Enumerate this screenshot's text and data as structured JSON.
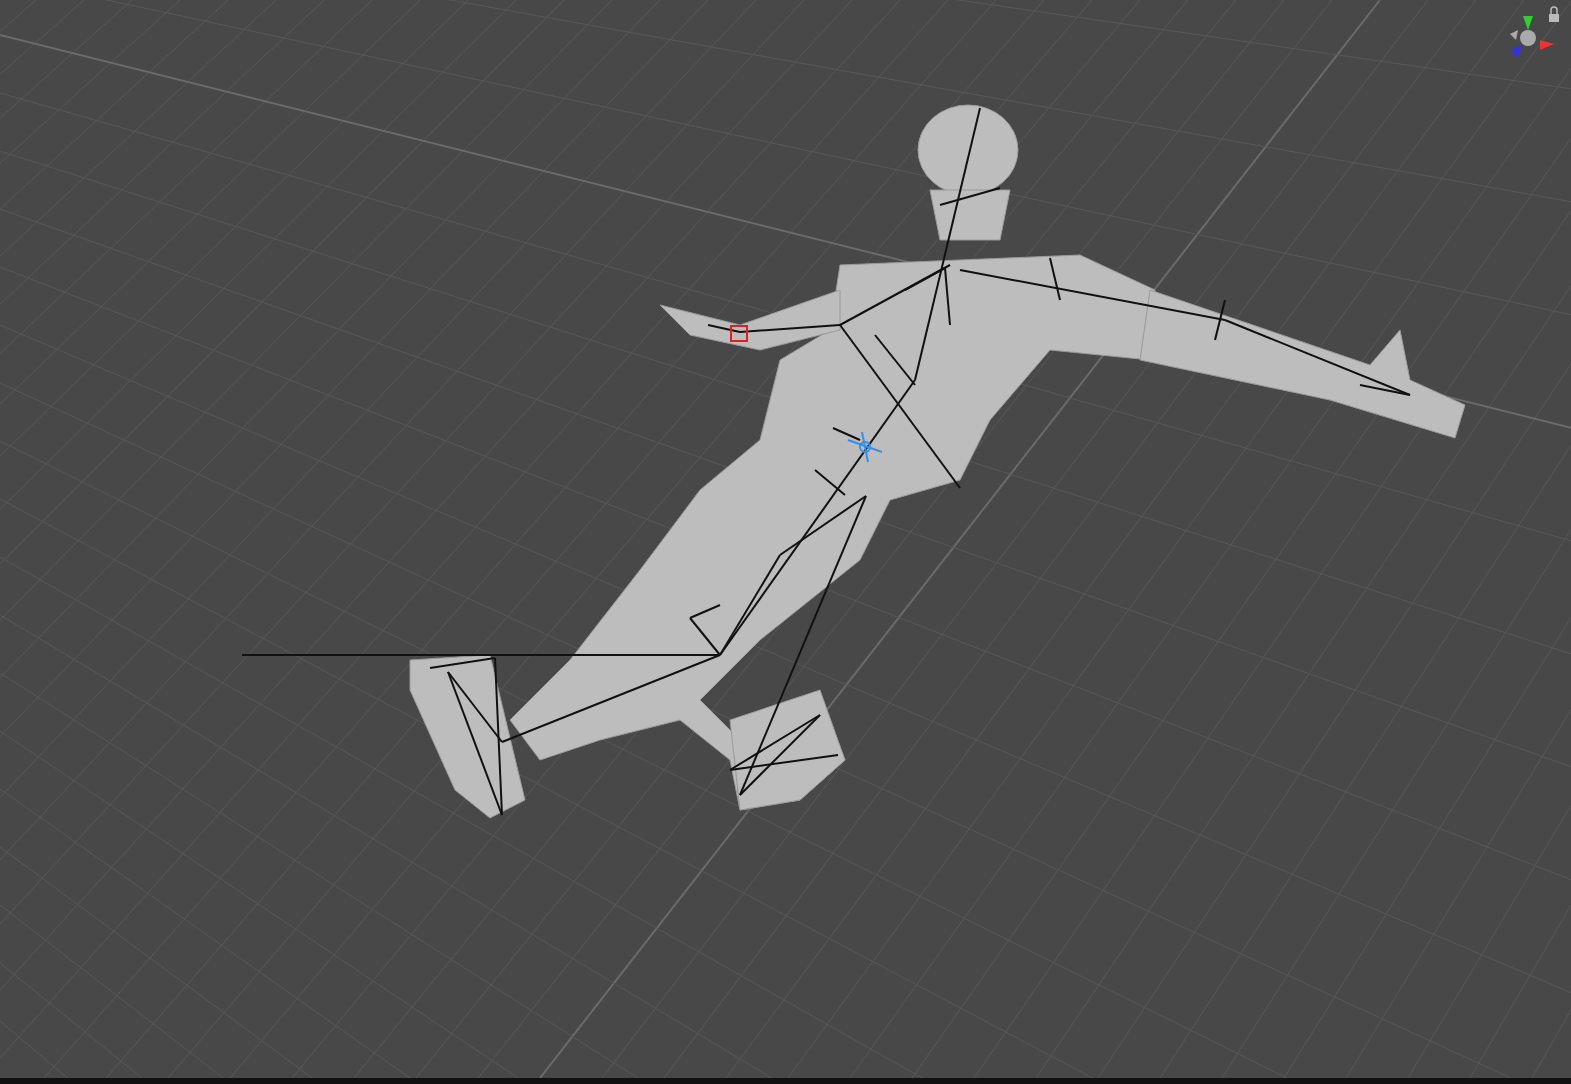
{
  "scene_view": {
    "show_grid": true,
    "locked": true
  }
}
